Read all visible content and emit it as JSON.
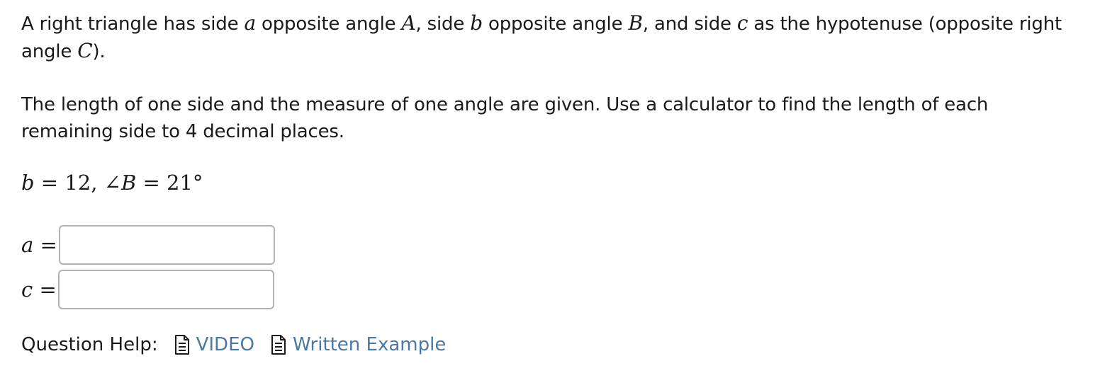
{
  "problem": {
    "intro": {
      "t1": "A right triangle has side ",
      "v_a": "a",
      "t2": " opposite angle ",
      "v_A": "A",
      "t3": ", side ",
      "v_b": "b",
      "t4": " opposite angle ",
      "v_B": "B",
      "t5": ", and side ",
      "v_c": "c",
      "t6": " as the hypotenuse (opposite right angle ",
      "v_C": "C",
      "t7": ")."
    },
    "instructions": "The length of one side and the measure of one angle are given. Use a calculator to find the length of each remaining side to 4 decimal places.",
    "given": {
      "side_var": "b",
      "eq1": " = 12,  ∠",
      "angle_var": "B",
      "eq2": " = 21°"
    }
  },
  "answers": [
    {
      "var": "a",
      "eq": " =",
      "value": ""
    },
    {
      "var": "c",
      "eq": " =",
      "value": ""
    }
  ],
  "help": {
    "label": "Question Help:",
    "links": [
      {
        "label": "VIDEO",
        "icon": "document-icon"
      },
      {
        "label": "Written Example",
        "icon": "document-icon"
      }
    ]
  },
  "colors": {
    "link": "#4b78a3",
    "text": "#1a1a1a",
    "input_border": "#b3b3b3"
  }
}
